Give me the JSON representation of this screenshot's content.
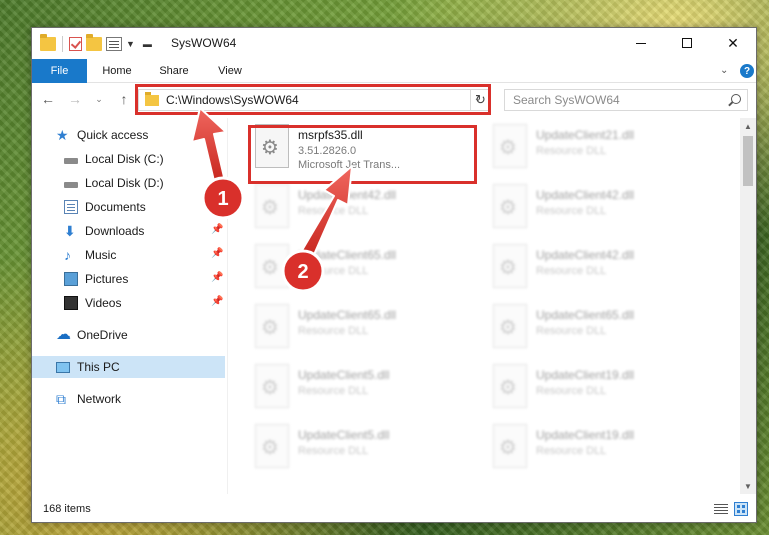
{
  "window": {
    "title": "SysWOW64"
  },
  "ribbon": {
    "tabs": [
      {
        "label": "File"
      },
      {
        "label": "Home"
      },
      {
        "label": "Share"
      },
      {
        "label": "View"
      }
    ],
    "help_label": "?"
  },
  "address_bar": {
    "path": "C:\\Windows\\SysWOW64"
  },
  "search": {
    "placeholder": "Search SysWOW64"
  },
  "sidebar": {
    "items": [
      {
        "label": "Quick access",
        "icon": "star-icon"
      },
      {
        "label": "Local Disk (C:)",
        "icon": "drive-icon"
      },
      {
        "label": "Local Disk (D:)",
        "icon": "drive-icon"
      },
      {
        "label": "Documents",
        "icon": "documents-icon",
        "pinned": true
      },
      {
        "label": "Downloads",
        "icon": "download-icon",
        "pinned": true
      },
      {
        "label": "Music",
        "icon": "music-icon",
        "pinned": true
      },
      {
        "label": "Pictures",
        "icon": "pictures-icon",
        "pinned": true
      },
      {
        "label": "Videos",
        "icon": "videos-icon",
        "pinned": true
      },
      {
        "label": "OneDrive",
        "icon": "onedrive-icon"
      },
      {
        "label": "This PC",
        "icon": "pc-icon",
        "selected": true
      },
      {
        "label": "Network",
        "icon": "network-icon"
      }
    ]
  },
  "files": {
    "highlighted": {
      "name": "msrpfs35.dll",
      "version": "3.51.2826.0",
      "description": "Microsoft Jet Trans..."
    },
    "others": [
      {
        "name": "UpdateClient21.dll",
        "description": "Resource DLL"
      },
      {
        "name": "UpdateClient42.dll",
        "description": "Resource DLL"
      },
      {
        "name": "UpdateClient42.dll",
        "description": "Resource DLL"
      },
      {
        "name": "UpdateClient65.dll",
        "description": "Resource DLL"
      },
      {
        "name": "UpdateClient42.dll",
        "description": "Resource DLL"
      },
      {
        "name": "UpdateClient65.dll",
        "description": "Resource DLL"
      },
      {
        "name": "UpdateClient65.dll",
        "description": "Resource DLL"
      },
      {
        "name": "UpdateClient5.dll",
        "description": "Resource DLL"
      },
      {
        "name": "UpdateClient19.dll",
        "description": "Resource DLL"
      },
      {
        "name": "UpdateClient5.dll",
        "description": "Resource DLL"
      },
      {
        "name": "UpdateClient19.dll",
        "description": "Resource DLL"
      }
    ]
  },
  "status_bar": {
    "item_count": "168 items"
  },
  "annotations": [
    {
      "label": "1"
    },
    {
      "label": "2"
    }
  ],
  "colors": {
    "accent": "#1979ca",
    "highlight_red": "#d9302b",
    "selected_bg": "#cce4f7"
  }
}
